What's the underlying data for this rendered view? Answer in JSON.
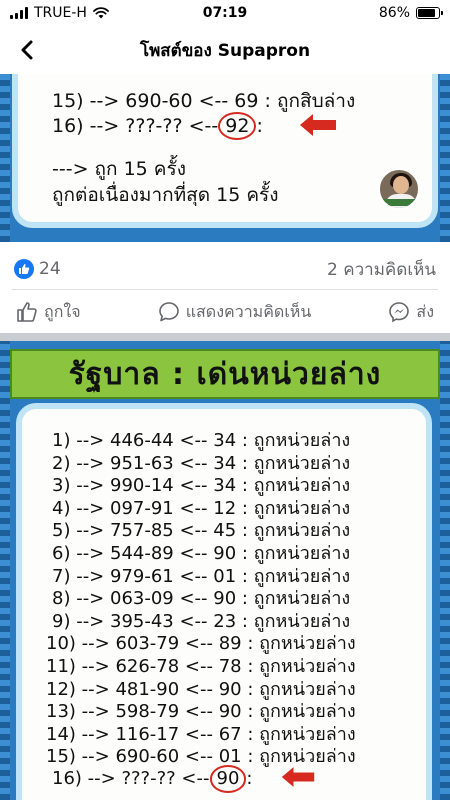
{
  "status_bar": {
    "carrier": "TRUE-H",
    "time": "07:19",
    "battery": "86%",
    "battery_level": 0.86
  },
  "nav": {
    "title": "โพสต์ของ Supapron"
  },
  "post1": {
    "lines": [
      "15) --> 690-60 <-- 69 : ถูกสิบล่าง",
      "16) --> ???-?? <--",
      "92",
      ":"
    ],
    "summary": [
      "---> ถูก 15 ครั้ง",
      "ถูกต่อเนื่องมากที่สุด 15 ครั้ง"
    ],
    "reactions": "24",
    "comments": "2 ความคิดเห็น"
  },
  "actions": {
    "like": "ถูกใจ",
    "comment": "แสดงความคิดเห็น",
    "share": "ส่ง"
  },
  "post2": {
    "title": "รัฐบาล : เด่นหน่วยล่าง",
    "lines": [
      "1) --> 446-44 <-- 34 : ถูกหน่วยล่าง",
      "2) --> 951-63 <-- 34 : ถูกหน่วยล่าง",
      "3) --> 990-14 <-- 34 : ถูกหน่วยล่าง",
      "4) --> 097-91 <-- 12 : ถูกหน่วยล่าง",
      "5) --> 757-85 <-- 45 : ถูกหน่วยล่าง",
      "6) --> 544-89 <-- 90 : ถูกหน่วยล่าง",
      "7) --> 979-61 <-- 01 : ถูกหน่วยล่าง",
      "8) --> 063-09 <-- 90 : ถูกหน่วยล่าง",
      "9) --> 395-43 <-- 23 : ถูกหน่วยล่าง",
      "10) --> 603-79 <-- 89 : ถูกหน่วยล่าง",
      "11) --> 626-78 <-- 78 : ถูกหน่วยล่าง",
      "12) --> 481-90 <-- 90 : ถูกหน่วยล่าง",
      "13) --> 598-79 <-- 90 : ถูกหน่วยล่าง",
      "14) --> 116-17 <-- 67 : ถูกหน่วยล่าง",
      "15) --> 690-60 <-- 01 : ถูกหน่วยล่าง"
    ],
    "last_prefix": "16) --> ???-?? <--",
    "last_circled": "90",
    "last_suffix": ":"
  },
  "icons": {
    "back": "chevron-left-icon",
    "like": "thumbs-up-icon",
    "comment": "speech-bubble-icon",
    "share": "messenger-icon"
  },
  "colors": {
    "facebook_blue": "#1877f2",
    "title_green": "#8bc53f",
    "frame_blue": "#2a7bbf",
    "highlight_red": "#d62a20"
  }
}
